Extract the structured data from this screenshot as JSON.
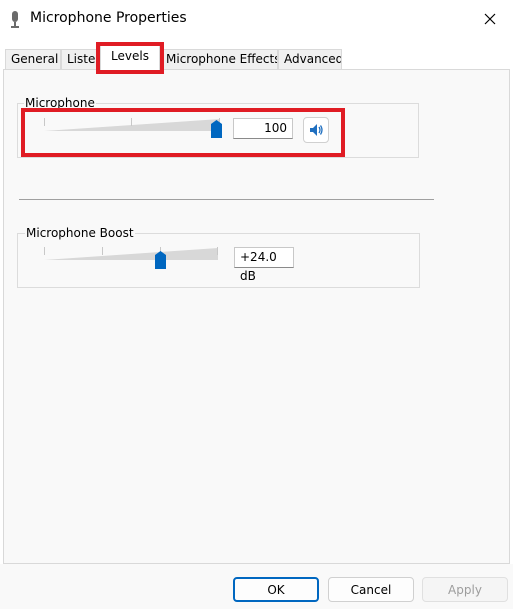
{
  "window": {
    "title": "Microphone Properties",
    "close_icon": "close-icon",
    "app_icon": "microphone-icon"
  },
  "tabs": [
    {
      "label": "General"
    },
    {
      "label": "Listen"
    },
    {
      "label": "Levels"
    },
    {
      "label": "Microphone Effects"
    },
    {
      "label": "Advanced"
    }
  ],
  "active_tab": "Levels",
  "levels": {
    "microphone": {
      "label": "Microphone",
      "value": "100",
      "level_percent": 100,
      "mute_icon": "speaker-icon"
    },
    "boost": {
      "label": "Microphone Boost",
      "value": "+24.0 dB",
      "level_fraction": 0.667
    }
  },
  "footer": {
    "ok": "OK",
    "cancel": "Cancel",
    "apply": "Apply"
  },
  "colors": {
    "accent": "#0067c0",
    "highlight": "#e01c24"
  }
}
